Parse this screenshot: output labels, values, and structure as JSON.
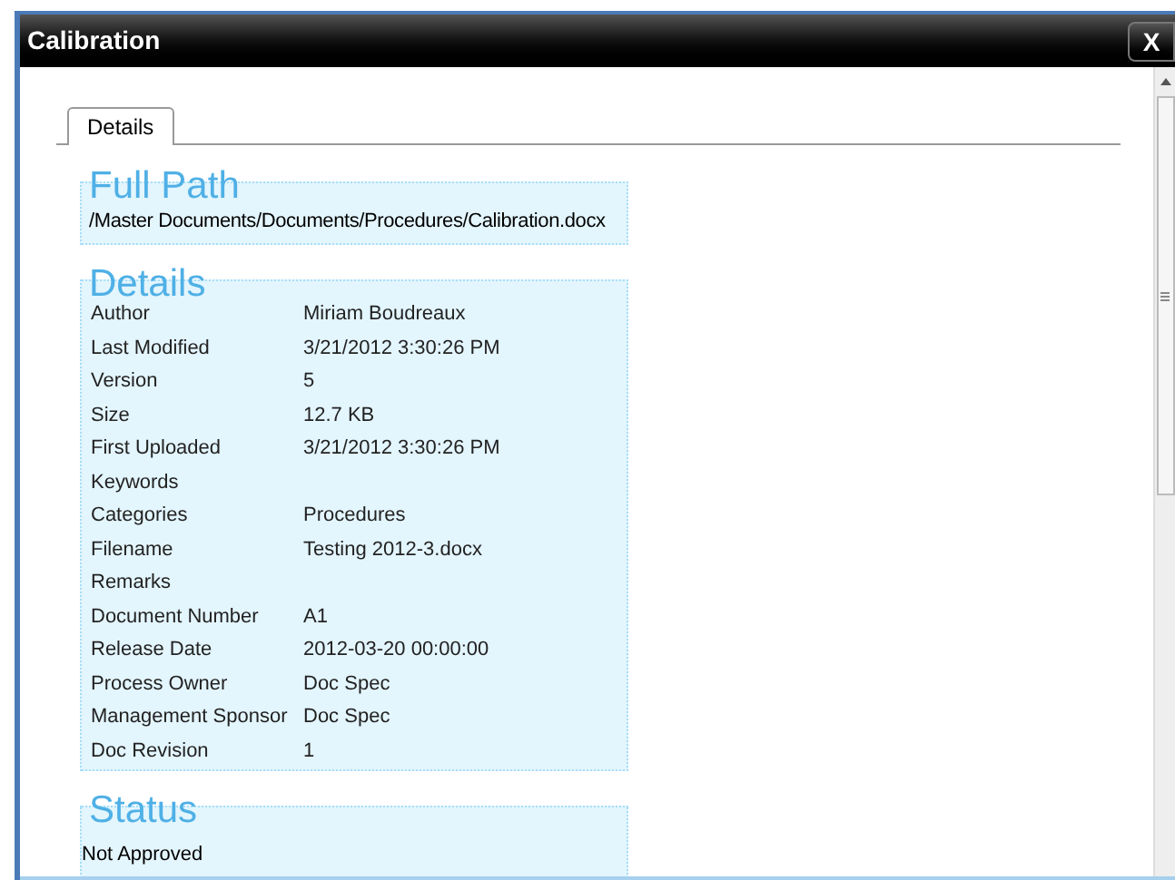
{
  "window": {
    "title": "Calibration",
    "close": "X"
  },
  "tabs": [
    {
      "label": "Details",
      "selected": true
    }
  ],
  "full_path": {
    "heading": "Full Path",
    "value": "/Master Documents/Documents/Procedures/Calibration.docx"
  },
  "details": {
    "heading": "Details",
    "rows": [
      {
        "label": "Author",
        "value": "Miriam Boudreaux"
      },
      {
        "label": "Last Modified",
        "value": "3/21/2012 3:30:26 PM"
      },
      {
        "label": "Version",
        "value": "5"
      },
      {
        "label": "Size",
        "value": "12.7 KB"
      },
      {
        "label": "First Uploaded",
        "value": "3/21/2012 3:30:26 PM"
      },
      {
        "label": "Keywords",
        "value": ""
      },
      {
        "label": "Categories",
        "value": "Procedures"
      },
      {
        "label": "Filename",
        "value": "Testing 2012-3.docx"
      },
      {
        "label": "Remarks",
        "value": ""
      },
      {
        "label": "Document Number",
        "value": "A1"
      },
      {
        "label": "Release Date",
        "value": "2012-03-20 00:00:00"
      },
      {
        "label": "Process Owner",
        "value": "Doc Spec"
      },
      {
        "label": "Management Sponsor",
        "value": "Doc Spec"
      },
      {
        "label": "Doc Revision",
        "value": "1"
      }
    ]
  },
  "status": {
    "heading": "Status",
    "value": "Not Approved"
  }
}
